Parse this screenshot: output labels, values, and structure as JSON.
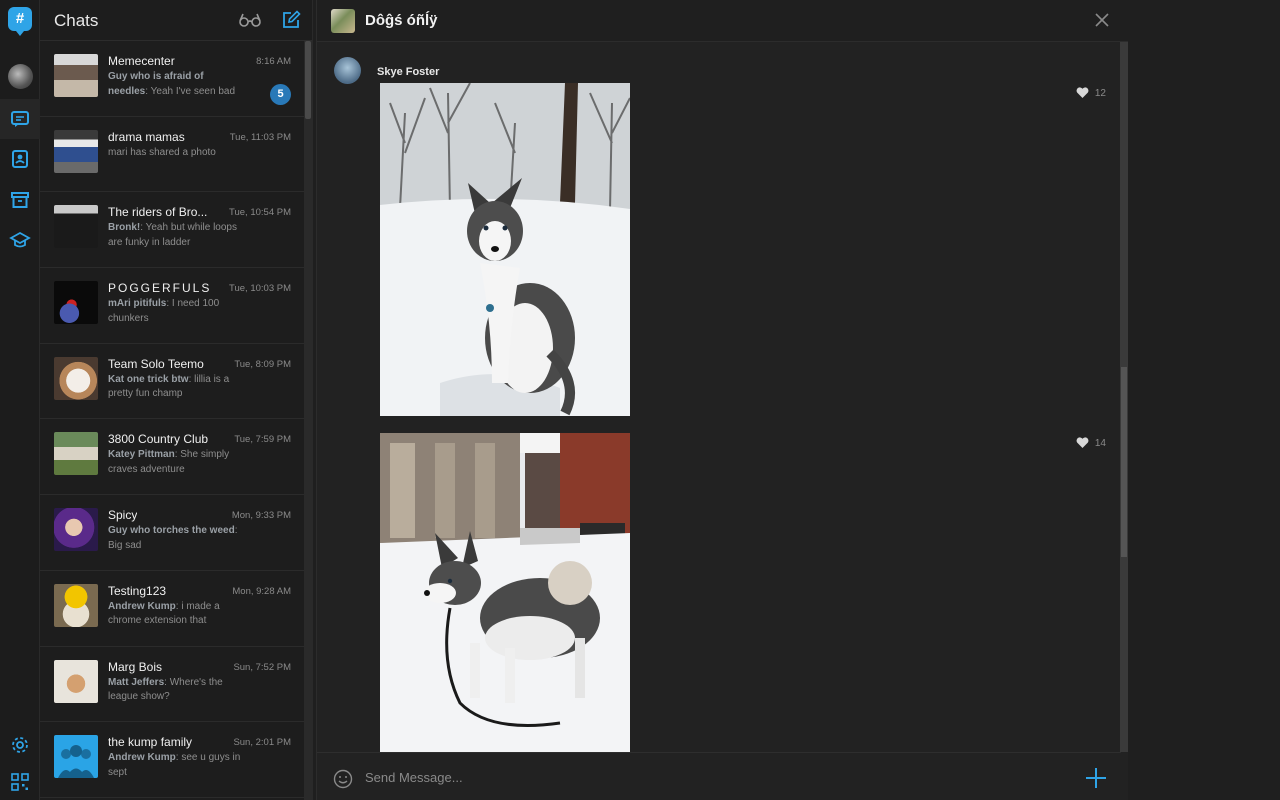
{
  "list": {
    "title": "Chats",
    "chats": [
      {
        "name": "Memecenter",
        "time": "8:16 AM",
        "sender": "Guy who is afraid of needles",
        "text": ": Yeah I've seen bad",
        "badge": "5"
      },
      {
        "name": "drama mamas",
        "time": "Tue, 11:03 PM",
        "sender": "",
        "text": "mari has shared a photo"
      },
      {
        "name": "The riders of Bro...",
        "time": "Tue, 10:54 PM",
        "sender": "Bronk!",
        "text": ": Yeah but while loops are funky in ladder"
      },
      {
        "name": "POGGERFULS",
        "time": "Tue, 10:03 PM",
        "sender": "mAri pitifuls",
        "text": ": I need 100 chunkers"
      },
      {
        "name": "Team Solo Teemo",
        "time": "Tue, 8:09 PM",
        "sender": "Kat one trick btw",
        "text": ": lillia is a pretty fun champ"
      },
      {
        "name": "3800 Country Club",
        "time": "Tue, 7:59 PM",
        "sender": "Katey Pittman",
        "text": ": She simply craves adventure"
      },
      {
        "name": "Spicy",
        "time": "Mon, 9:33 PM",
        "sender": "Guy who torches the weed",
        "text": ": Big sad"
      },
      {
        "name": "Testing123",
        "time": "Mon, 9:28 AM",
        "sender": "Andrew Kump",
        "text": ": i made a chrome extension that"
      },
      {
        "name": "Marg Bois",
        "time": "Sun, 7:52 PM",
        "sender": "Matt Jeffers",
        "text": ": Where's the league show?"
      },
      {
        "name": "the kump family",
        "time": "Sun, 2:01 PM",
        "sender": "Andrew Kump",
        "text": ": see u guys in sept"
      }
    ]
  },
  "conversation": {
    "title": "Dôĝś óñĺÿ",
    "author": "Skye Foster",
    "photos": [
      {
        "likes": "12"
      },
      {
        "likes": "14"
      }
    ],
    "composer_placeholder": "Send Message..."
  },
  "colors": {
    "accent": "#2fa4e7",
    "badge": "#2979b8"
  }
}
